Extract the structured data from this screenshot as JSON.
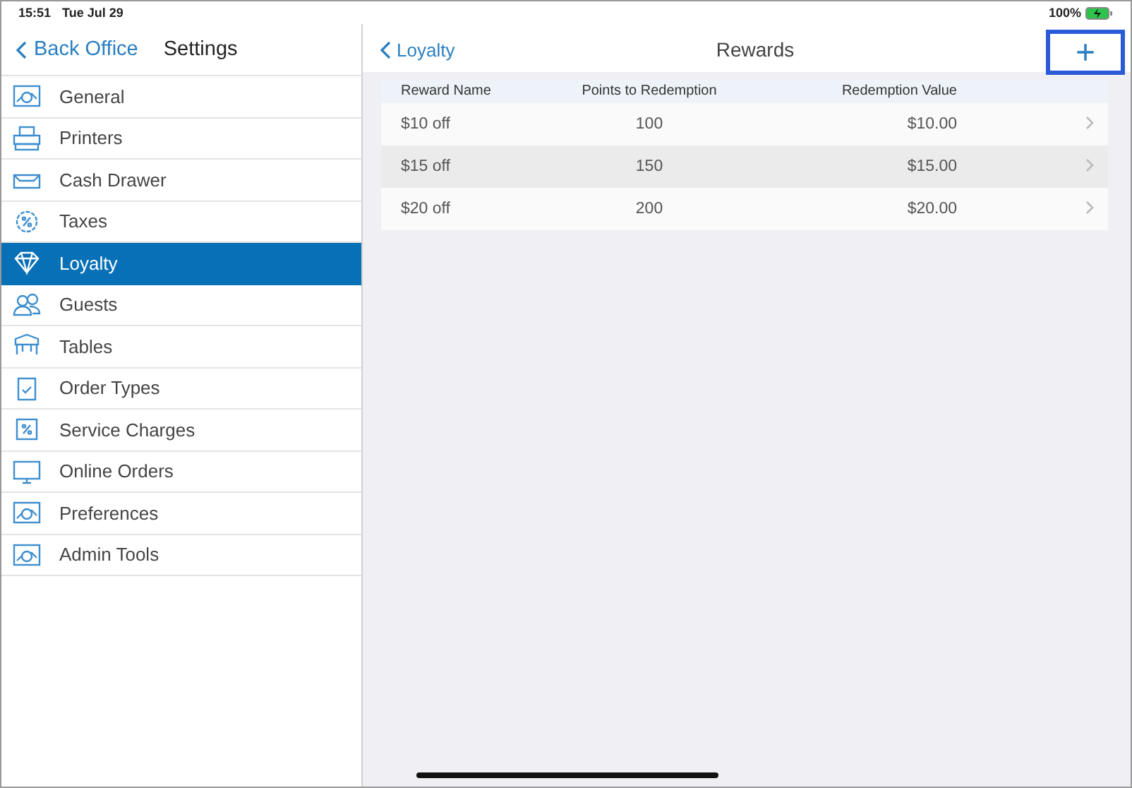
{
  "status_bar": {
    "time": "15:51",
    "date": "Tue Jul 29",
    "battery": "100%",
    "charging": true
  },
  "sidebar": {
    "back": "Back Office",
    "title": "Settings",
    "items": [
      {
        "label": "General",
        "selected": false
      },
      {
        "label": "Printers",
        "selected": false
      },
      {
        "label": "Cash Drawer",
        "selected": false
      },
      {
        "label": "Taxes",
        "selected": false
      },
      {
        "label": "Loyalty",
        "selected": true
      },
      {
        "label": "Guests",
        "selected": false
      },
      {
        "label": "Tables",
        "selected": false
      },
      {
        "label": "Order Types",
        "selected": false
      },
      {
        "label": "Service Charges",
        "selected": false
      },
      {
        "label": "Online Orders",
        "selected": false
      },
      {
        "label": "Preferences",
        "selected": false
      },
      {
        "label": "Admin Tools",
        "selected": false
      }
    ]
  },
  "detail": {
    "back": "Loyalty",
    "title": "Rewards",
    "add_button": {
      "label": "+",
      "highlighted": true
    },
    "table": {
      "columns": [
        "Reward Name",
        "Points to Redemption",
        "Redemption Value"
      ],
      "rows": [
        {
          "cells": [
            "$10 off",
            "100",
            "$10.00"
          ],
          "selected": false
        },
        {
          "cells": [
            "$15 off",
            "150",
            "$15.00"
          ],
          "selected": true
        },
        {
          "cells": [
            "$20 off",
            "200",
            "$20.00"
          ],
          "selected": false
        }
      ]
    }
  }
}
